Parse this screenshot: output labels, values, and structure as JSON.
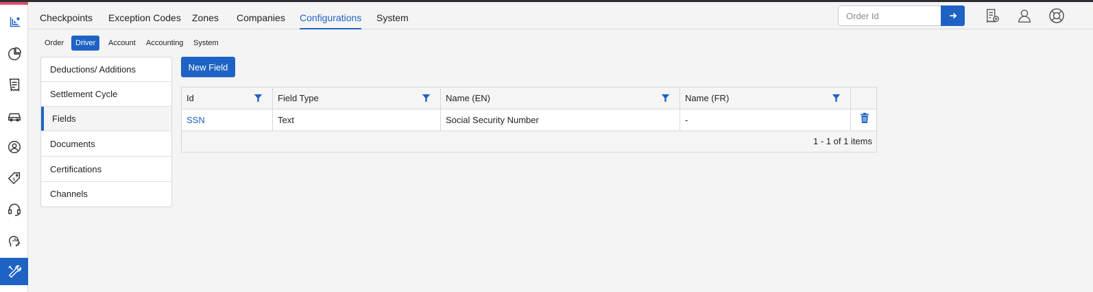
{
  "colors": {
    "accent": "#1e63c4",
    "rail_top_accent": "#e0506d"
  },
  "rail": {
    "items": [
      {
        "icon": "logo-icon"
      },
      {
        "icon": "pie-chart-icon"
      },
      {
        "icon": "receipt-icon"
      },
      {
        "icon": "car-icon"
      },
      {
        "icon": "user-circle-icon"
      },
      {
        "icon": "price-tag-icon"
      },
      {
        "icon": "headset-icon"
      },
      {
        "icon": "analytics-head-icon"
      },
      {
        "icon": "tools-icon",
        "active": true
      }
    ]
  },
  "topnav": {
    "tabs": [
      {
        "label": "Checkpoints"
      },
      {
        "label": "Exception Codes"
      },
      {
        "label": "Zones"
      },
      {
        "label": "Companies"
      },
      {
        "label": "Configurations",
        "active": true
      },
      {
        "label": "System"
      }
    ],
    "order_search": {
      "placeholder": "Order Id",
      "value": ""
    },
    "icons": [
      "add-document-icon",
      "user-profile-icon",
      "help-lifebuoy-icon"
    ]
  },
  "subnav": {
    "tabs": [
      {
        "label": "Order"
      },
      {
        "label": "Driver",
        "active": true
      },
      {
        "label": "Account"
      },
      {
        "label": "Accounting"
      },
      {
        "label": "System"
      }
    ]
  },
  "sidemenu": {
    "items": [
      {
        "label": "Deductions/ Additions"
      },
      {
        "label": "Settlement Cycle"
      },
      {
        "label": "Fields",
        "active": true
      },
      {
        "label": "Documents"
      },
      {
        "label": "Certifications"
      },
      {
        "label": "Channels"
      }
    ]
  },
  "main": {
    "new_button_label": "New Field",
    "grid": {
      "columns": [
        {
          "label": "Id"
        },
        {
          "label": "Field Type"
        },
        {
          "label": "Name (EN)"
        },
        {
          "label": "Name (FR)"
        }
      ],
      "rows": [
        {
          "id": "SSN",
          "field_type": "Text",
          "name_en": "Social Security Number",
          "name_fr": "-"
        }
      ],
      "pager_info": "1 - 1 of 1 items"
    }
  }
}
